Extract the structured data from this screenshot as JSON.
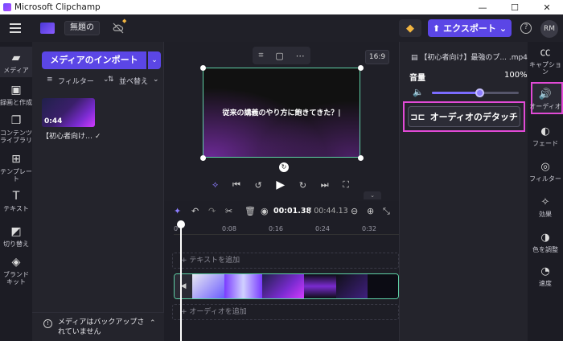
{
  "window": {
    "title": "Microsoft Clipchamp",
    "controls": [
      "—",
      "☐",
      "✕"
    ]
  },
  "topbar": {
    "project_title": "無題の",
    "export_label": "エクスポート",
    "avatar_initials": "RM"
  },
  "left_nav": {
    "items": [
      {
        "label": "メディア",
        "icon": "folder-icon"
      },
      {
        "label": "録画と作成",
        "icon": "camera-icon"
      },
      {
        "label": "コンテンツ ライブラリ",
        "icon": "library-icon"
      },
      {
        "label": "テンプレート",
        "icon": "template-icon"
      },
      {
        "label": "テキスト",
        "icon": "text-icon"
      },
      {
        "label": "切り替え",
        "icon": "transition-icon"
      },
      {
        "label": "ブランド キット",
        "icon": "brand-icon"
      }
    ]
  },
  "media": {
    "import_label": "メディアのインポート",
    "filter_label": "フィルター",
    "sort_label": "並べ替え",
    "item_duration": "0:44",
    "item_name": "【初心者向け…",
    "backup_note": "メディアはバックアップされていません"
  },
  "preview": {
    "aspect_ratio": "16:9",
    "canvas_text": "従来の講義のやり方に飽きてきた？|"
  },
  "timeline": {
    "current_time": "00:01.38",
    "total_time": "/ 00:44.13",
    "ruler_ticks": [
      "0",
      "0:08",
      "0:16",
      "0:24",
      "0:32"
    ],
    "add_text_label": "+ テキストを追加",
    "add_audio_label": "+ オーディオを追加"
  },
  "properties": {
    "file_name": "【初心者向け】最強のプ... .mp4",
    "volume_label": "音量",
    "volume_value": "100%",
    "volume_level": 0.55,
    "detach_audio_label": "オーディオのデタッチ"
  },
  "right_nav": {
    "items": [
      {
        "label": "キャプション",
        "icon": "captions-icon"
      },
      {
        "label": "オーディオ",
        "icon": "audio-icon"
      },
      {
        "label": "フェード",
        "icon": "fade-icon"
      },
      {
        "label": "フィルター",
        "icon": "filter-icon"
      },
      {
        "label": "効果",
        "icon": "effects-icon"
      },
      {
        "label": "色を調整",
        "icon": "color-adjust-icon"
      },
      {
        "label": "速度",
        "icon": "speed-icon"
      }
    ]
  },
  "colors": {
    "accent": "#5b46e6",
    "highlight": "#e14ad6",
    "selection": "#5fd0a6"
  }
}
